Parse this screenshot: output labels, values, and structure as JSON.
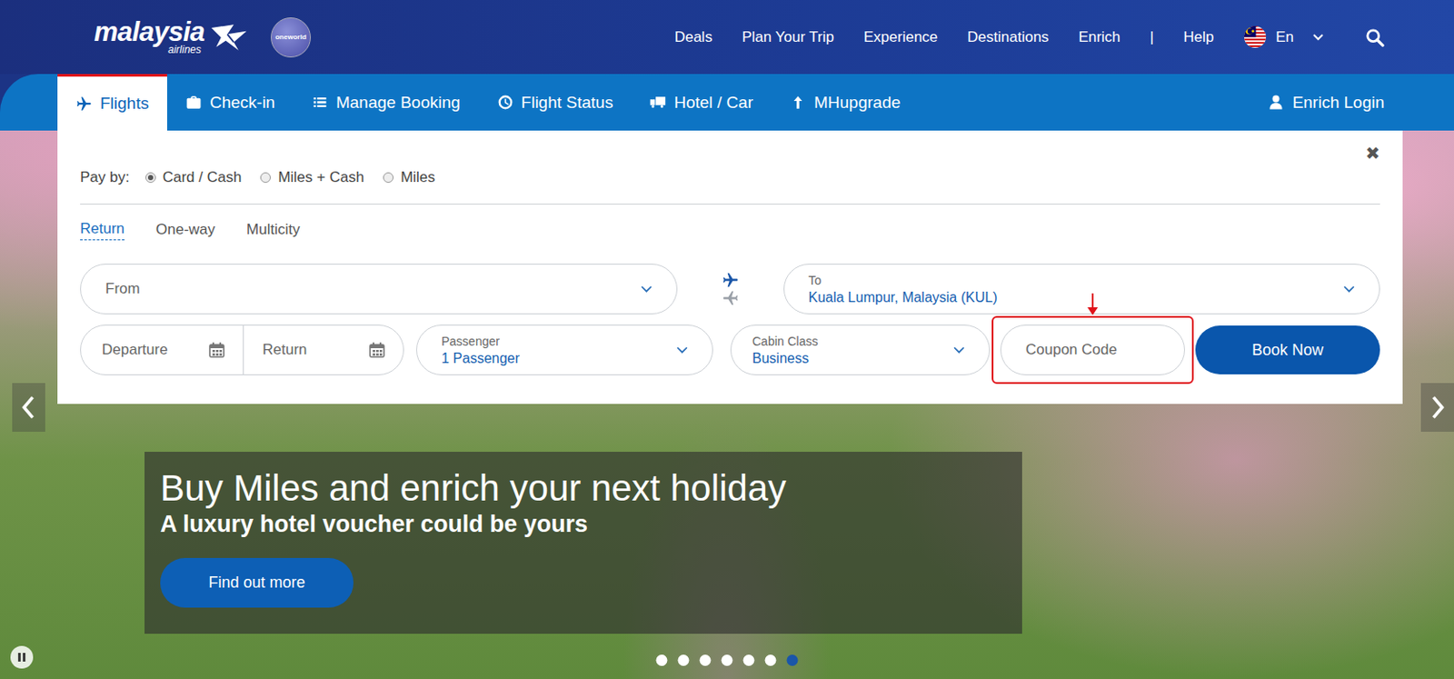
{
  "logo": {
    "wordmark": "malaysia",
    "sub": "airlines",
    "alliance": "oneworld"
  },
  "nav": {
    "links": [
      "Deals",
      "Plan Your Trip",
      "Experience",
      "Destinations",
      "Enrich"
    ],
    "separator": "|",
    "help": "Help",
    "language": "En"
  },
  "tabs": [
    {
      "label": "Flights",
      "selected": true
    },
    {
      "label": "Check-in",
      "selected": false
    },
    {
      "label": "Manage Booking",
      "selected": false
    },
    {
      "label": "Flight Status",
      "selected": false
    },
    {
      "label": "Hotel / Car",
      "selected": false
    },
    {
      "label": "MHupgrade",
      "selected": false
    }
  ],
  "login": "Enrich Login",
  "booking": {
    "close": "✖",
    "pay_by": {
      "label": "Pay by:",
      "options": [
        {
          "label": "Card / Cash",
          "selected": true
        },
        {
          "label": "Miles + Cash",
          "selected": false
        },
        {
          "label": "Miles",
          "selected": false
        }
      ]
    },
    "trip_types": [
      {
        "label": "Return",
        "selected": true
      },
      {
        "label": "One-way",
        "selected": false
      },
      {
        "label": "Multicity",
        "selected": false
      }
    ],
    "from": {
      "placeholder": "From"
    },
    "to": {
      "label": "To",
      "value": "Kuala Lumpur, Malaysia (KUL)"
    },
    "departure": {
      "placeholder": "Departure"
    },
    "return": {
      "placeholder": "Return"
    },
    "passenger": {
      "label": "Passenger",
      "value": "1 Passenger"
    },
    "cabin": {
      "label": "Cabin Class",
      "value": "Business"
    },
    "coupon": {
      "placeholder": "Coupon Code",
      "highlighted": true
    },
    "submit": "Book Now"
  },
  "banner": {
    "title": "Buy Miles and enrich your next holiday",
    "subtitle": "A luxury hotel voucher could be yours",
    "button": "Find out more"
  },
  "carousel": {
    "slides": [
      {
        "selected": false
      },
      {
        "selected": false
      },
      {
        "selected": false
      },
      {
        "selected": false
      },
      {
        "selected": false
      },
      {
        "selected": false
      },
      {
        "selected": true
      }
    ],
    "paused": false
  }
}
